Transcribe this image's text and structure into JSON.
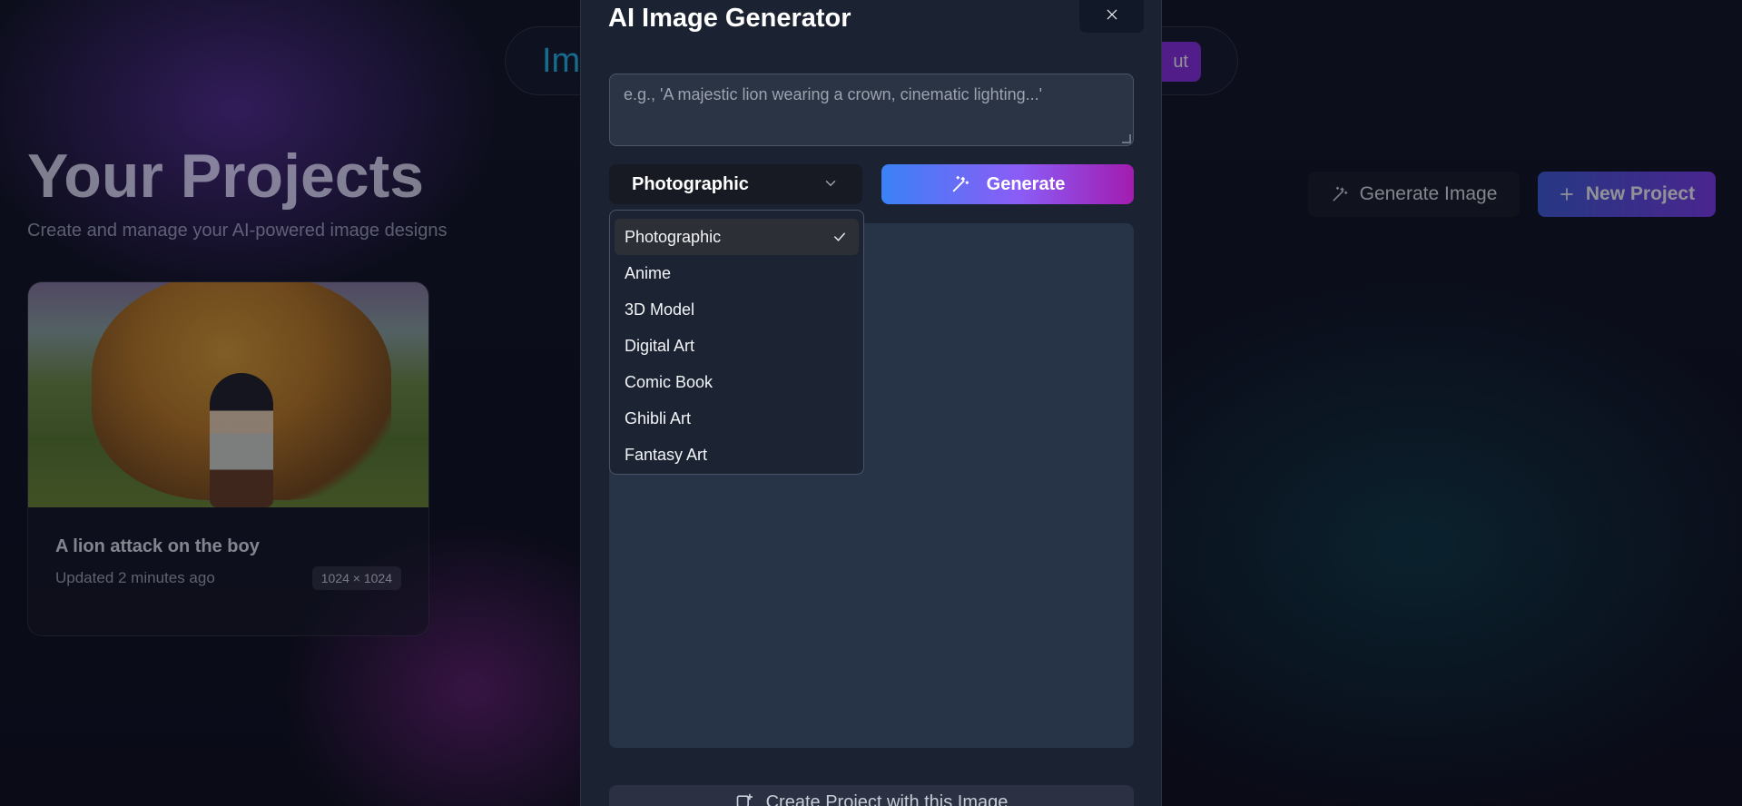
{
  "page": {
    "brand_partial": "Ima",
    "logout_partial": "ut",
    "title": "Your Projects",
    "subtitle": "Create and manage your AI-powered image designs",
    "generate_image_label": "Generate Image",
    "new_project_label": "New Project"
  },
  "project_card": {
    "name": "A lion attack on the boy",
    "updated": "Updated 2 minutes ago",
    "dimensions": "1024 × 1024"
  },
  "modal": {
    "title": "AI Image Generator",
    "close_label": "×",
    "prompt_placeholder": "e.g., 'A majestic lion wearing a crown, cinematic lighting...'",
    "prompt_value": "",
    "style_selected": "Photographic",
    "generate_label": "Generate",
    "create_project_label": "Create Project with this Image",
    "style_options": [
      {
        "label": "Photographic",
        "selected": true
      },
      {
        "label": "Anime",
        "selected": false
      },
      {
        "label": "3D Model",
        "selected": false
      },
      {
        "label": "Digital Art",
        "selected": false
      },
      {
        "label": "Comic Book",
        "selected": false
      },
      {
        "label": "Ghibli Art",
        "selected": false
      },
      {
        "label": "Fantasy Art",
        "selected": false
      }
    ]
  },
  "icons": {
    "generate": "magic-wand-icon",
    "new_project": "plus-icon",
    "close": "close-icon",
    "select": "chevron-down-icon",
    "selected_option": "check-icon",
    "create_project": "image-plus-icon"
  },
  "colors": {
    "accent_gradient_start": "#3b82f6",
    "accent_gradient_end": "#a21caf",
    "brand": "#22b8e8",
    "modal_bg": "#1b2232"
  }
}
